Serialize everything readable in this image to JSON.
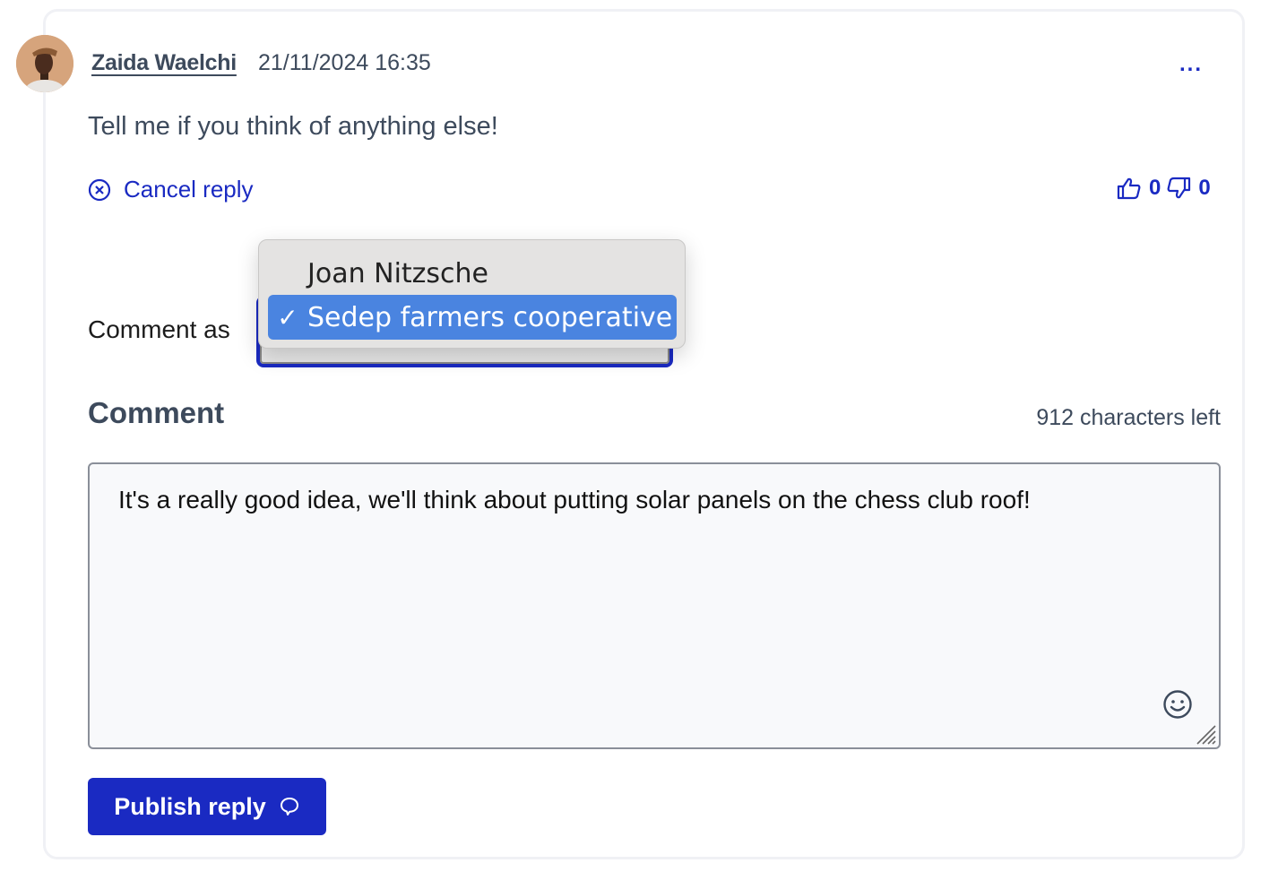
{
  "comment": {
    "author": "Zaida Waelchi",
    "timestamp": "21/11/2024 16:35",
    "body": "Tell me if you think of anything else!",
    "more_label": "...",
    "cancel_reply_label": "Cancel reply",
    "upvotes": "0",
    "downvotes": "0"
  },
  "reply_form": {
    "comment_as_label": "Comment as",
    "comment_as_options": [
      {
        "label": "Joan Nitzsche",
        "selected": false
      },
      {
        "label": "Sedep farmers cooperative",
        "selected": true
      }
    ],
    "check_mark": "✓",
    "comment_label": "Comment",
    "chars_left": "912 characters left",
    "textarea_value": "It's a really good idea, we'll think about putting solar panels on the chess club roof!",
    "publish_label": "Publish reply"
  },
  "colors": {
    "accent": "#1a2ac2",
    "selected_option": "#4a84e0",
    "text": "#3d4a5c"
  }
}
